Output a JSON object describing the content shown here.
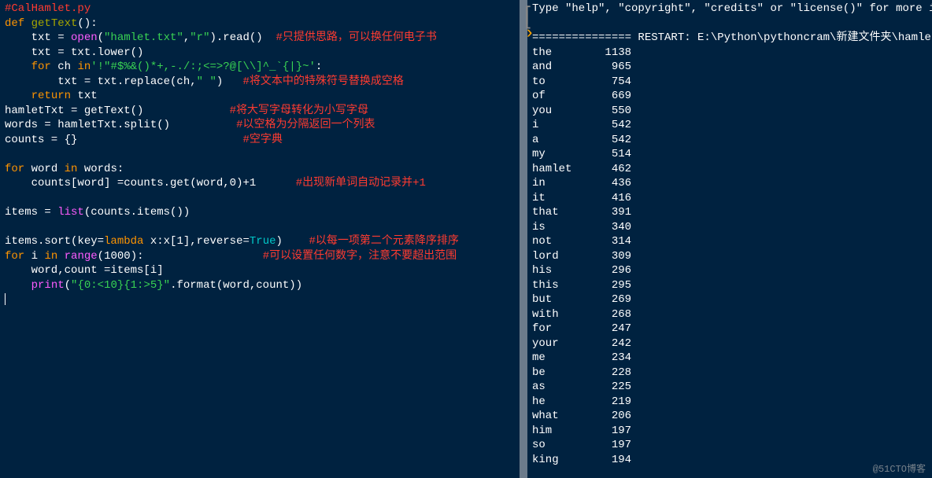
{
  "editor": {
    "lines": [
      [
        {
          "cls": "tok-red",
          "t": "#CalHamlet.py"
        }
      ],
      [
        {
          "cls": "tok-orange",
          "t": "def "
        },
        {
          "cls": "tok-olive",
          "t": "getText"
        },
        {
          "cls": "tok-white",
          "t": "():"
        }
      ],
      [
        {
          "cls": "tok-white",
          "t": "    txt = "
        },
        {
          "cls": "tok-magenta",
          "t": "open"
        },
        {
          "cls": "tok-white",
          "t": "("
        },
        {
          "cls": "tok-green",
          "t": "\"hamlet.txt\""
        },
        {
          "cls": "tok-white",
          "t": ","
        },
        {
          "cls": "tok-green",
          "t": "\"r\""
        },
        {
          "cls": "tok-white",
          "t": ").read()  "
        },
        {
          "cls": "tok-red",
          "t": "#只提供思路，可以换任何电子书"
        }
      ],
      [
        {
          "cls": "tok-white",
          "t": "    txt = txt.lower()"
        }
      ],
      [
        {
          "cls": "tok-white",
          "t": "    "
        },
        {
          "cls": "tok-orange",
          "t": "for"
        },
        {
          "cls": "tok-white",
          "t": " ch "
        },
        {
          "cls": "tok-orange",
          "t": "in"
        },
        {
          "cls": "tok-green",
          "t": "'!\"#$%&()*+,-./:;<=>?@[\\\\]^_`{|}~'"
        },
        {
          "cls": "tok-white",
          "t": ":"
        }
      ],
      [
        {
          "cls": "tok-white",
          "t": "        txt = txt.replace(ch,"
        },
        {
          "cls": "tok-green",
          "t": "\" \""
        },
        {
          "cls": "tok-white",
          "t": ")   "
        },
        {
          "cls": "tok-red",
          "t": "#将文本中的特殊符号替换成空格"
        }
      ],
      [
        {
          "cls": "tok-white",
          "t": "    "
        },
        {
          "cls": "tok-orange",
          "t": "return"
        },
        {
          "cls": "tok-white",
          "t": " txt"
        }
      ],
      [
        {
          "cls": "tok-white",
          "t": "hamletTxt = getText()             "
        },
        {
          "cls": "tok-red",
          "t": "#将大写字母转化为小写字母"
        }
      ],
      [
        {
          "cls": "tok-white",
          "t": "words = hamletTxt.split()          "
        },
        {
          "cls": "tok-red",
          "t": "#以空格为分隔返回一个列表"
        }
      ],
      [
        {
          "cls": "tok-white",
          "t": "counts = {}                         "
        },
        {
          "cls": "tok-red",
          "t": "#空字典"
        }
      ],
      [
        {
          "cls": "tok-white",
          "t": " "
        }
      ],
      [
        {
          "cls": "tok-orange",
          "t": "for"
        },
        {
          "cls": "tok-white",
          "t": " word "
        },
        {
          "cls": "tok-orange",
          "t": "in"
        },
        {
          "cls": "tok-white",
          "t": " words:"
        }
      ],
      [
        {
          "cls": "tok-white",
          "t": "    counts[word] =counts.get(word,"
        },
        {
          "cls": "tok-white",
          "t": "0"
        },
        {
          "cls": "tok-white",
          "t": ")+"
        },
        {
          "cls": "tok-white",
          "t": "1"
        },
        {
          "cls": "tok-white",
          "t": "      "
        },
        {
          "cls": "tok-red",
          "t": "#出现新单词自动记录并+1"
        }
      ],
      [
        {
          "cls": "tok-white",
          "t": " "
        }
      ],
      [
        {
          "cls": "tok-white",
          "t": "items = "
        },
        {
          "cls": "tok-magenta",
          "t": "list"
        },
        {
          "cls": "tok-white",
          "t": "(counts.items())"
        }
      ],
      [
        {
          "cls": "tok-white",
          "t": " "
        }
      ],
      [
        {
          "cls": "tok-white",
          "t": "items.sort(key="
        },
        {
          "cls": "tok-orange",
          "t": "lambda"
        },
        {
          "cls": "tok-white",
          "t": " x:x["
        },
        {
          "cls": "tok-white",
          "t": "1"
        },
        {
          "cls": "tok-white",
          "t": "],reverse="
        },
        {
          "cls": "tok-teal",
          "t": "True"
        },
        {
          "cls": "tok-white",
          "t": ")    "
        },
        {
          "cls": "tok-red",
          "t": "#以每一项第二个元素降序排序"
        }
      ],
      [
        {
          "cls": "tok-orange",
          "t": "for"
        },
        {
          "cls": "tok-white",
          "t": " i "
        },
        {
          "cls": "tok-orange",
          "t": "in"
        },
        {
          "cls": "tok-white",
          "t": " "
        },
        {
          "cls": "tok-magenta",
          "t": "range"
        },
        {
          "cls": "tok-white",
          "t": "("
        },
        {
          "cls": "tok-white",
          "t": "1000"
        },
        {
          "cls": "tok-white",
          "t": "):                  "
        },
        {
          "cls": "tok-red",
          "t": "#可以设置任何数字，注意不要超出范围"
        }
      ],
      [
        {
          "cls": "tok-white",
          "t": "    word,count =items[i]"
        }
      ],
      [
        {
          "cls": "tok-white",
          "t": "    "
        },
        {
          "cls": "tok-magenta",
          "t": "print"
        },
        {
          "cls": "tok-white",
          "t": "("
        },
        {
          "cls": "tok-green",
          "t": "\"{0:<10}{1:>5}\""
        },
        {
          "cls": "tok-white",
          "t": ".format(word,count))"
        }
      ]
    ]
  },
  "shell": {
    "intro": "Type \"help\", \"copyright\", \"credits\" or \"license()\" for more information.",
    "restart": "=============== RESTART: E:\\Python\\pythoncram\\新建文件夹\\hamlet词频统",
    "freq": [
      {
        "w": "the",
        "c": "1138"
      },
      {
        "w": "and",
        "c": "965"
      },
      {
        "w": "to",
        "c": "754"
      },
      {
        "w": "of",
        "c": "669"
      },
      {
        "w": "you",
        "c": "550"
      },
      {
        "w": "i",
        "c": "542"
      },
      {
        "w": "a",
        "c": "542"
      },
      {
        "w": "my",
        "c": "514"
      },
      {
        "w": "hamlet",
        "c": "462"
      },
      {
        "w": "in",
        "c": "436"
      },
      {
        "w": "it",
        "c": "416"
      },
      {
        "w": "that",
        "c": "391"
      },
      {
        "w": "is",
        "c": "340"
      },
      {
        "w": "not",
        "c": "314"
      },
      {
        "w": "lord",
        "c": "309"
      },
      {
        "w": "his",
        "c": "296"
      },
      {
        "w": "this",
        "c": "295"
      },
      {
        "w": "but",
        "c": "269"
      },
      {
        "w": "with",
        "c": "268"
      },
      {
        "w": "for",
        "c": "247"
      },
      {
        "w": "your",
        "c": "242"
      },
      {
        "w": "me",
        "c": "234"
      },
      {
        "w": "be",
        "c": "228"
      },
      {
        "w": "as",
        "c": "225"
      },
      {
        "w": "he",
        "c": "219"
      },
      {
        "w": "what",
        "c": "206"
      },
      {
        "w": "him",
        "c": "197"
      },
      {
        "w": "so",
        "c": "197"
      },
      {
        "w": "king",
        "c": "194"
      }
    ]
  },
  "watermark": "@51CTO博客"
}
